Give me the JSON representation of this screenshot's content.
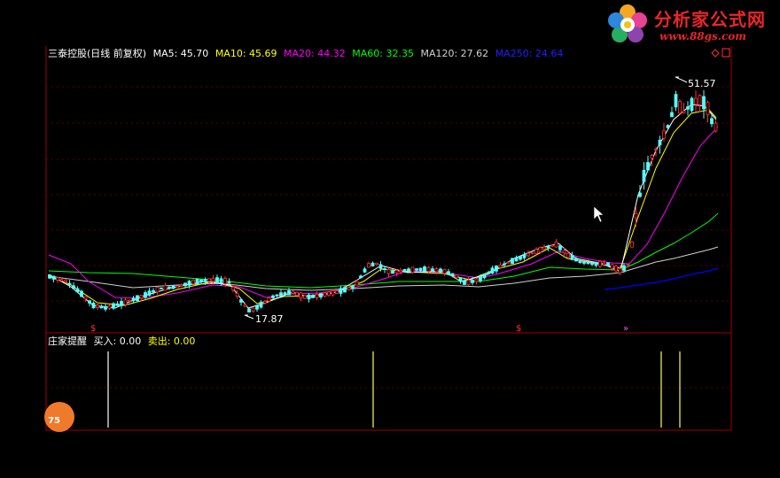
{
  "header": {
    "stock_name": "三泰控股(日线 前复权)",
    "ma": [
      {
        "label": "MA5: 45.70",
        "color": "#ffffff"
      },
      {
        "label": "MA10: 45.69",
        "color": "#ffff00"
      },
      {
        "label": "MA20: 44.32",
        "color": "#ff00ff"
      },
      {
        "label": "MA60: 32.35",
        "color": "#00ff00"
      },
      {
        "label": "MA120: 27.62",
        "color": "#d0d0d0"
      },
      {
        "label": "MA250: 24.64",
        "color": "#0000ff"
      }
    ]
  },
  "price_chart": {
    "high_label": "51.57",
    "low_label": "17.87",
    "signal_markers": [
      "$",
      "$",
      "»"
    ]
  },
  "indicator": {
    "title": "庄家提醒",
    "buy_label": "买入: 0.00",
    "sell_label": "卖出: 0.00",
    "buy_color": "#ffffff",
    "sell_color": "#ffff00"
  },
  "logo": {
    "title": "分析家公式网",
    "url": "www.88gs.com"
  },
  "badge": "75",
  "colors": {
    "up": "#ff3232",
    "down": "#54ffff",
    "axis": "#a00000",
    "grid": "#800000"
  }
}
